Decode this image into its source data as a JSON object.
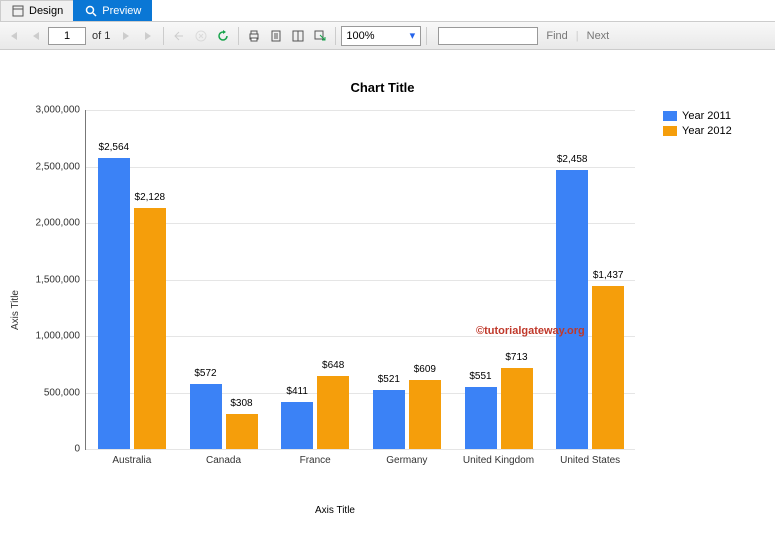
{
  "tabs": {
    "design": "Design",
    "preview": "Preview"
  },
  "toolbar": {
    "page_current": "1",
    "of_text": "of  1",
    "zoom": "100%",
    "find": "Find",
    "next": "Next"
  },
  "chart_data": {
    "type": "bar",
    "title": "Chart Title",
    "xlabel": "Axis Title",
    "ylabel": "Axis Title",
    "ylim": [
      0,
      3000000
    ],
    "yticks": [
      0,
      500000,
      1000000,
      1500000,
      2000000,
      2500000,
      3000000
    ],
    "categories": [
      "Australia",
      "Canada",
      "France",
      "Germany",
      "United Kingdom",
      "United States"
    ],
    "series": [
      {
        "name": "Year 2011",
        "color": "#3b82f6",
        "values": [
          2564000,
          572000,
          411000,
          521000,
          551000,
          2458000
        ],
        "labels": [
          "$2,564",
          "$572",
          "$411",
          "$521",
          "$551",
          "$2,458"
        ]
      },
      {
        "name": "Year 2012",
        "color": "#f59e0b",
        "values": [
          2128000,
          308000,
          648000,
          609000,
          713000,
          1437000
        ],
        "labels": [
          "$2,128",
          "$308",
          "$648",
          "$609",
          "$713",
          "$1,437"
        ]
      }
    ],
    "watermark": "©tutorialgateway.org"
  }
}
